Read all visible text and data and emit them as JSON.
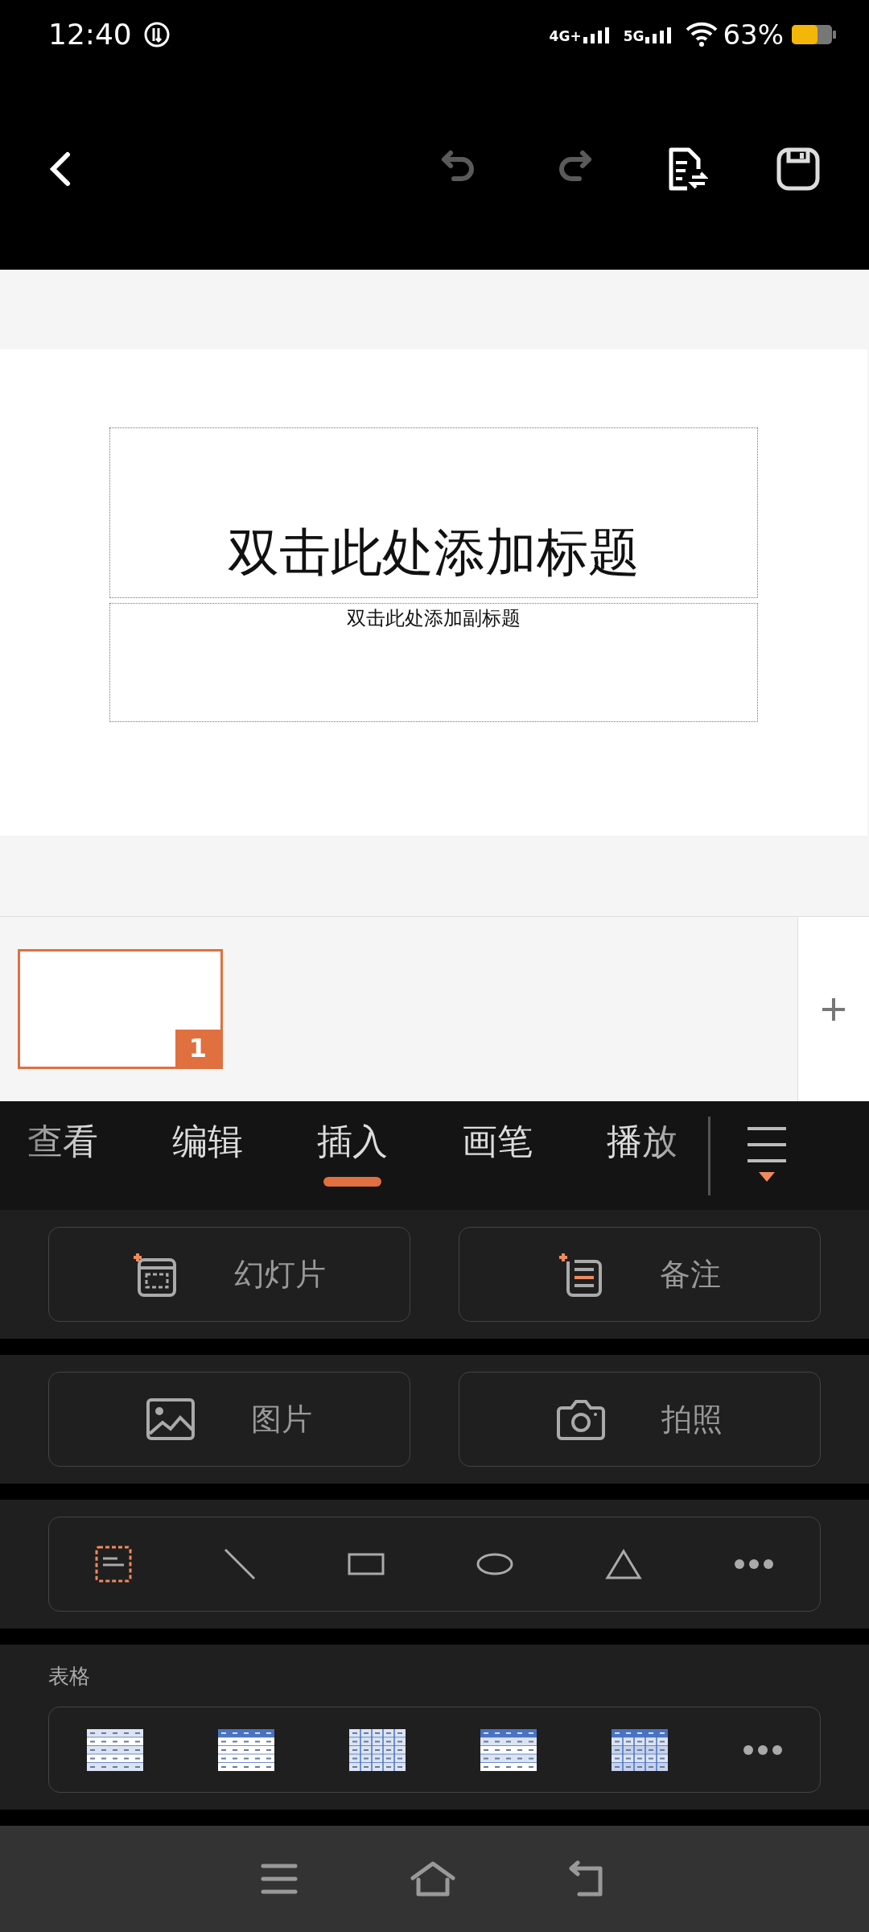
{
  "status_bar": {
    "time": "12:40",
    "network_1": "4G+",
    "network_2": "5G",
    "battery": "63%"
  },
  "toolbar": {
    "undo": {
      "disabled": true
    },
    "redo": {
      "disabled": true
    }
  },
  "slide": {
    "title_placeholder": "双击此处添加标题",
    "subtitle_placeholder": "双击此处添加副标题"
  },
  "slides": [
    {
      "number": "1",
      "selected": true
    }
  ],
  "tabs": [
    {
      "label": "查看",
      "selected": false
    },
    {
      "label": "编辑",
      "selected": false
    },
    {
      "label": "插入",
      "selected": true
    },
    {
      "label": "画笔",
      "selected": false
    },
    {
      "label": "播放",
      "selected": false
    }
  ],
  "insert_rows": [
    [
      {
        "label": "幻灯片",
        "kind": "new-slide"
      },
      {
        "label": "备注",
        "kind": "note"
      }
    ],
    [
      {
        "label": "图片",
        "kind": "image"
      },
      {
        "label": "拍照",
        "kind": "camera"
      }
    ]
  ],
  "shapes": [
    {
      "kind": "textbox"
    },
    {
      "kind": "line"
    },
    {
      "kind": "rectangle"
    },
    {
      "kind": "ellipse"
    },
    {
      "kind": "triangle"
    },
    {
      "kind": "more"
    }
  ],
  "tables": {
    "label": "表格",
    "styles": [
      {
        "kind": "light-banded"
      },
      {
        "kind": "blue-header"
      },
      {
        "kind": "grid"
      },
      {
        "kind": "blue-header-banded"
      },
      {
        "kind": "blue-grid"
      },
      {
        "kind": "more"
      }
    ]
  }
}
